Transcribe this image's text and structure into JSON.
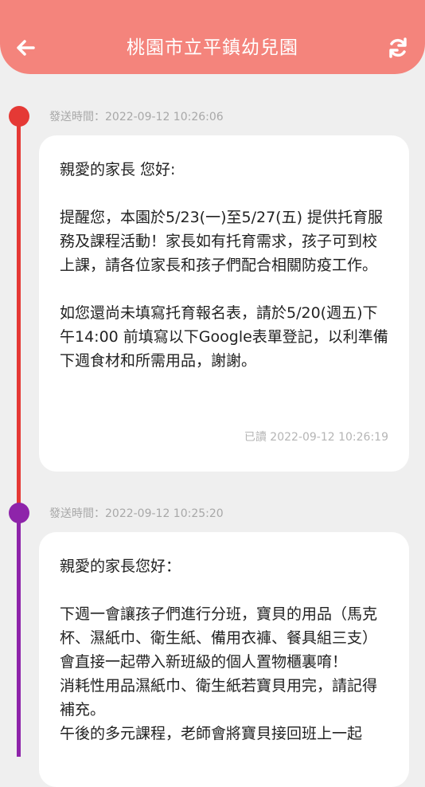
{
  "header": {
    "title": "桃園市立平鎮幼兒園",
    "back_icon": "arrow-left-icon",
    "refresh_icon": "refresh-icon"
  },
  "colors": {
    "header": "#f4847c",
    "timeline_red": "#e53935",
    "timeline_purple": "#8e24aa"
  },
  "messages": [
    {
      "send_time": "發送時間：2022-09-12 10:26:06",
      "greeting": "親愛的家長 您好:",
      "paragraphs": [
        "提醒您，本園於5/23(一)至5/27(五) 提供托育服務及課程活動！家長如有托育需求，孩子可到校上課，請各位家長和孩子們配合相關防疫工作。",
        "如您還尚未填寫托育報名表，請於5/20(週五)下午14:00 前填寫以下Google表單登記，以利準備下週食材和所需用品，謝謝。"
      ],
      "read_status": "已讀 2022-09-12 10:26:19"
    },
    {
      "send_time": "發送時間：2022-09-12 10:25:20",
      "greeting": "親愛的家長您好：",
      "paragraphs": [
        "下週一會讓孩子們進行分班，寶貝的用品（馬克杯、濕紙巾、衛生紙、備用衣褲、餐具組三支）會直接一起帶入新班級的個人置物櫃裏唷！\n消耗性用品濕紙巾、衛生紙若寶貝用完，請記得補充。\n午後的多元課程，老師會將寶貝接回班上一起"
      ]
    }
  ]
}
